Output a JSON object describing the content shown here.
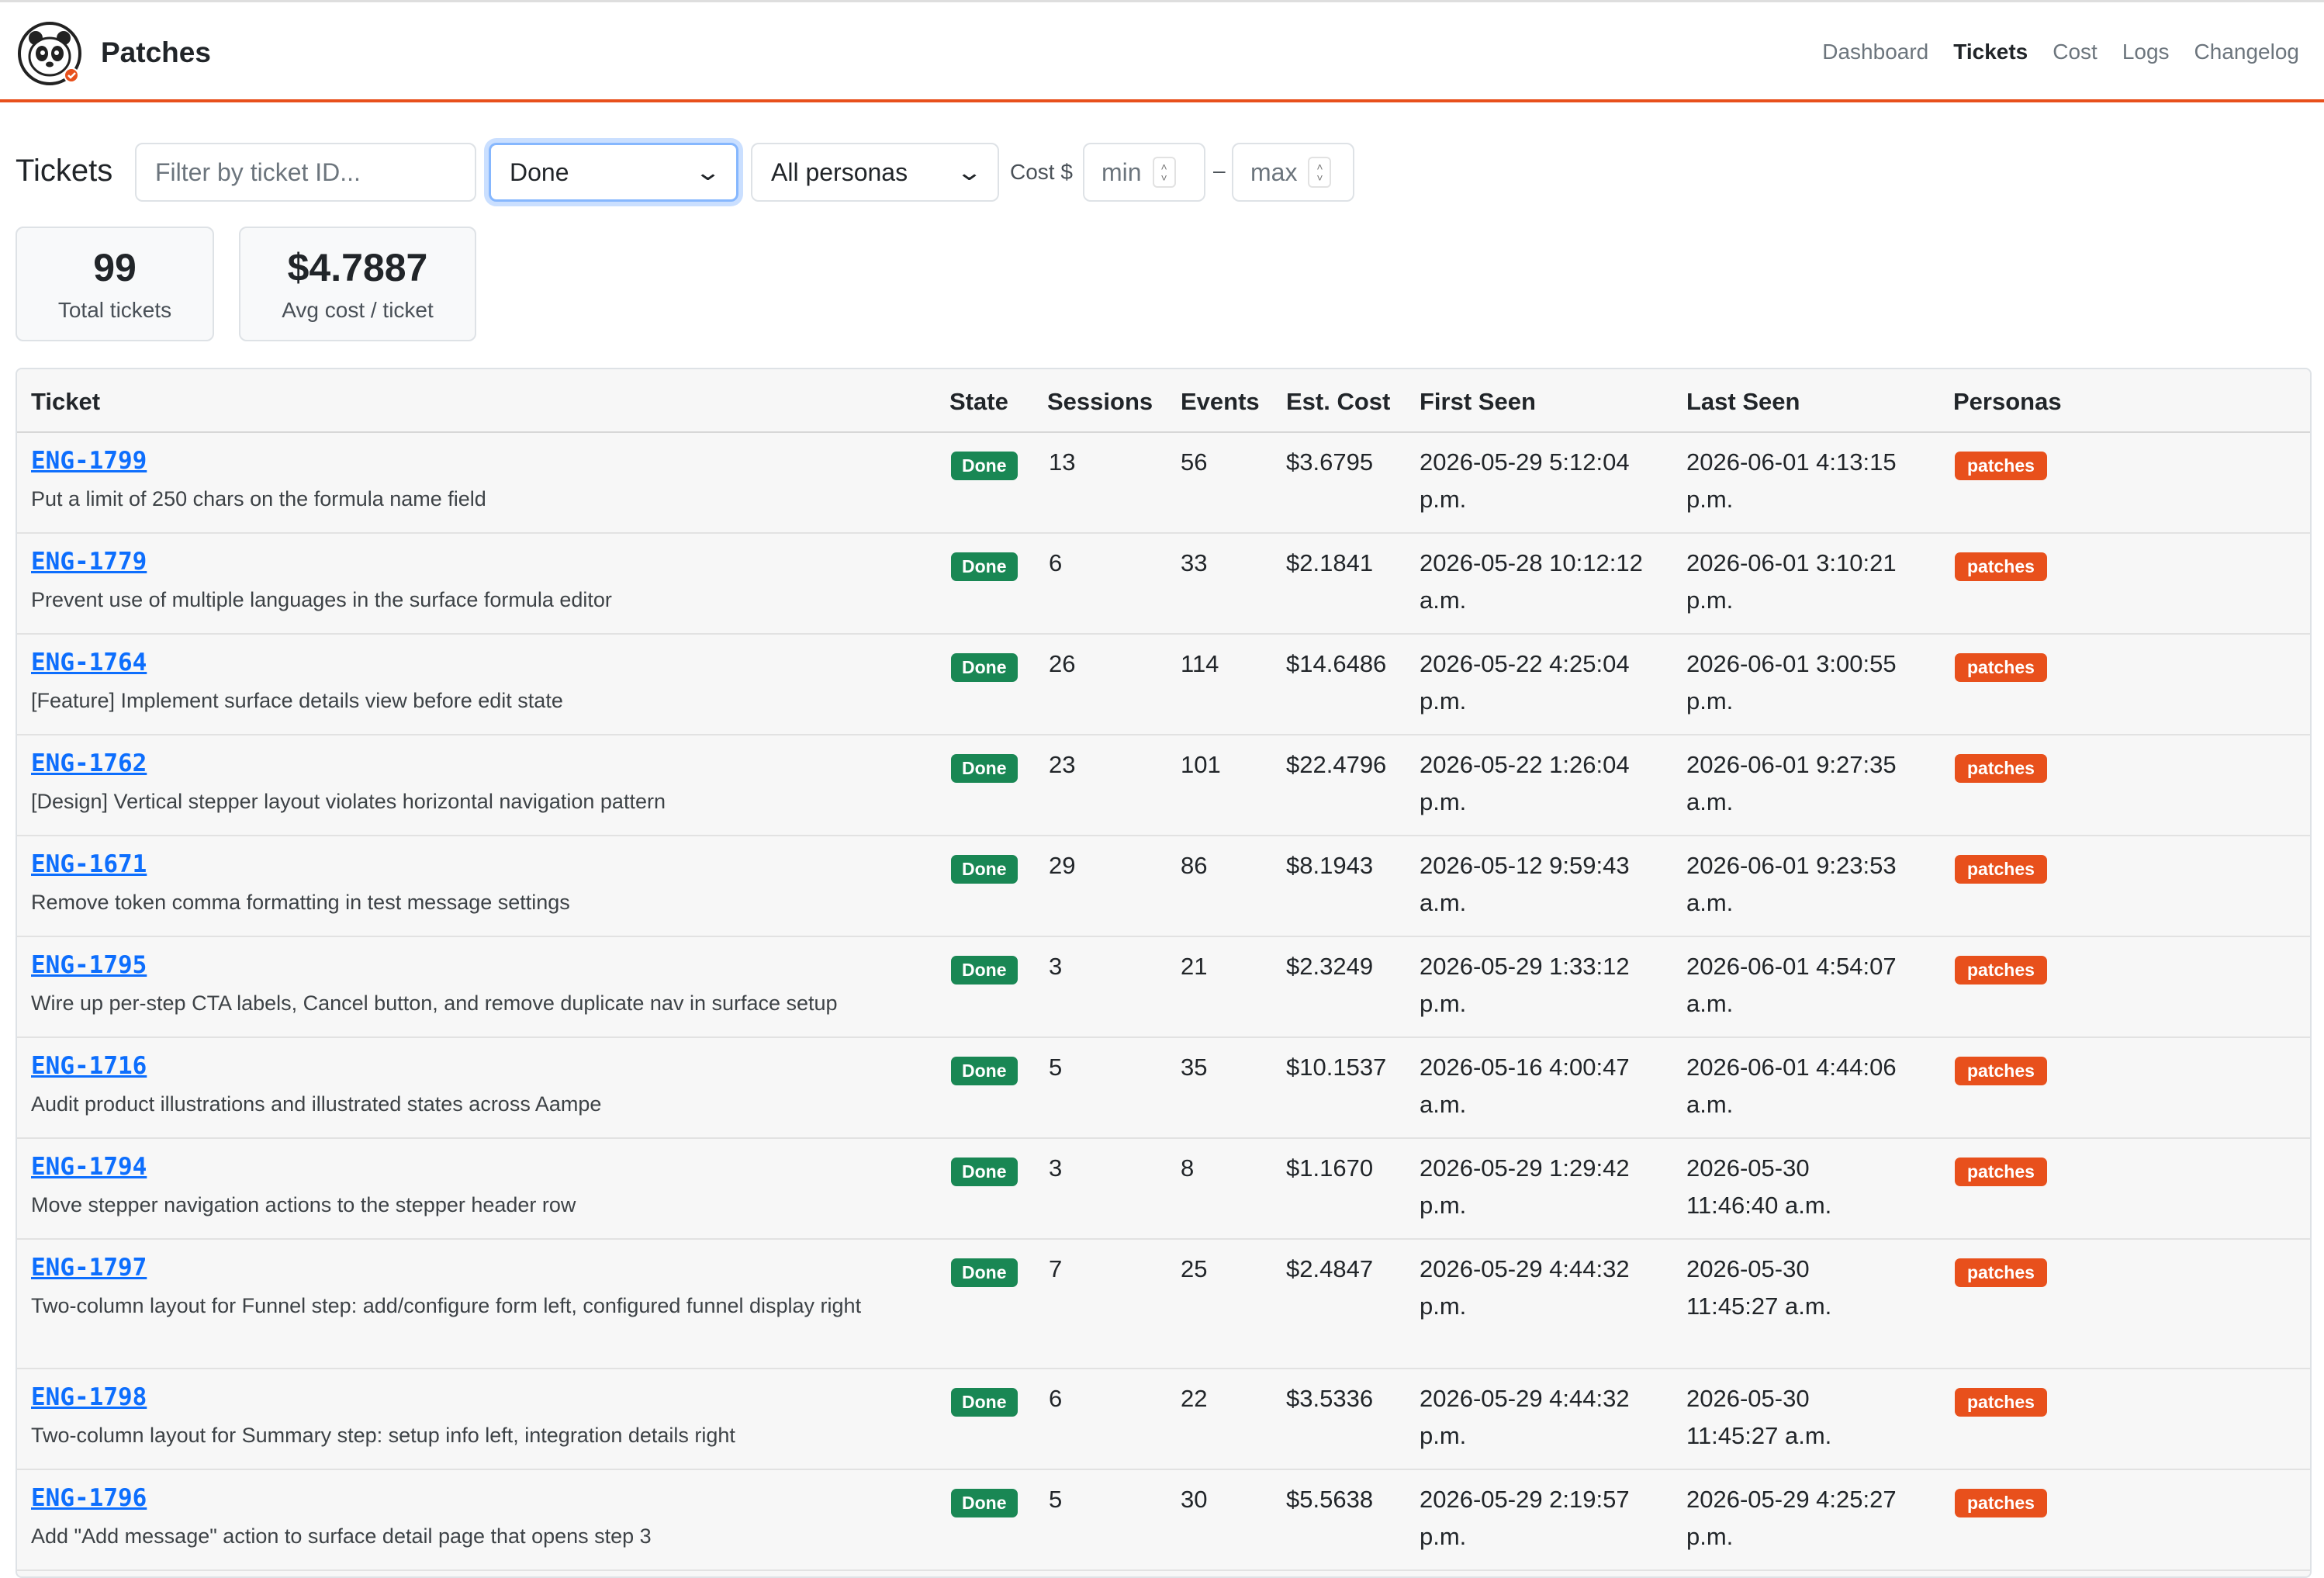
{
  "app": {
    "title": "Patches"
  },
  "nav": [
    {
      "label": "Dashboard",
      "active": false
    },
    {
      "label": "Tickets",
      "active": true
    },
    {
      "label": "Cost",
      "active": false
    },
    {
      "label": "Logs",
      "active": false
    },
    {
      "label": "Changelog",
      "active": false
    }
  ],
  "filters": {
    "title": "Tickets",
    "ticket_placeholder": "Filter by ticket ID...",
    "state_selected": "Done",
    "persona_selected": "All personas",
    "cost_label": "Cost $",
    "min_placeholder": "min",
    "max_placeholder": "max",
    "range_dash": "–"
  },
  "stats": {
    "total": {
      "value": "99",
      "label": "Total tickets"
    },
    "avg": {
      "value": "$4.7887",
      "label": "Avg cost / ticket"
    }
  },
  "table": {
    "headers": [
      "Ticket",
      "State",
      "Sessions",
      "Events",
      "Est. Cost",
      "First Seen",
      "Last Seen",
      "Personas"
    ],
    "rows": [
      {
        "id": "ENG-1799",
        "desc": "Put a limit of 250 chars on the formula name field",
        "state": "Done",
        "sessions": "13",
        "events": "56",
        "cost": "$3.6795",
        "first1": "2026-05-29 5:12:04",
        "first2": "p.m.",
        "last1": "2026-06-01 4:13:15",
        "last2": "p.m.",
        "persona": "patches"
      },
      {
        "id": "ENG-1779",
        "desc": "Prevent use of multiple languages in the surface formula editor",
        "state": "Done",
        "sessions": "6",
        "events": "33",
        "cost": "$2.1841",
        "first1": "2026-05-28 10:12:12",
        "first2": "a.m.",
        "last1": "2026-06-01 3:10:21",
        "last2": "p.m.",
        "persona": "patches"
      },
      {
        "id": "ENG-1764",
        "desc": "[Feature] Implement surface details view before edit state",
        "state": "Done",
        "sessions": "26",
        "events": "114",
        "cost": "$14.6486",
        "first1": "2026-05-22 4:25:04",
        "first2": "p.m.",
        "last1": "2026-06-01 3:00:55",
        "last2": "p.m.",
        "persona": "patches"
      },
      {
        "id": "ENG-1762",
        "desc": "[Design] Vertical stepper layout violates horizontal navigation pattern",
        "state": "Done",
        "sessions": "23",
        "events": "101",
        "cost": "$22.4796",
        "first1": "2026-05-22 1:26:04",
        "first2": "p.m.",
        "last1": "2026-06-01 9:27:35",
        "last2": "a.m.",
        "persona": "patches"
      },
      {
        "id": "ENG-1671",
        "desc": "Remove token comma formatting in test message settings",
        "state": "Done",
        "sessions": "29",
        "events": "86",
        "cost": "$8.1943",
        "first1": "2026-05-12 9:59:43",
        "first2": "a.m.",
        "last1": "2026-06-01 9:23:53",
        "last2": "a.m.",
        "persona": "patches"
      },
      {
        "id": "ENG-1795",
        "desc": "Wire up per-step CTA labels, Cancel button, and remove duplicate nav in surface setup",
        "state": "Done",
        "sessions": "3",
        "events": "21",
        "cost": "$2.3249",
        "first1": "2026-05-29 1:33:12",
        "first2": "p.m.",
        "last1": "2026-06-01 4:54:07",
        "last2": "a.m.",
        "persona": "patches"
      },
      {
        "id": "ENG-1716",
        "desc": "Audit product illustrations and illustrated states across Aampe",
        "state": "Done",
        "sessions": "5",
        "events": "35",
        "cost": "$10.1537",
        "first1": "2026-05-16 4:00:47",
        "first2": "a.m.",
        "last1": "2026-06-01 4:44:06",
        "last2": "a.m.",
        "persona": "patches"
      },
      {
        "id": "ENG-1794",
        "desc": "Move stepper navigation actions to the stepper header row",
        "state": "Done",
        "sessions": "3",
        "events": "8",
        "cost": "$1.1670",
        "first1": "2026-05-29 1:29:42",
        "first2": "p.m.",
        "last1": "2026-05-30",
        "last2": "11:46:40 a.m.",
        "persona": "patches"
      },
      {
        "id": "ENG-1797",
        "desc": "Two-column layout for Funnel step: add/configure form left, configured funnel display right",
        "state": "Done",
        "sessions": "7",
        "events": "25",
        "cost": "$2.4847",
        "first1": "2026-05-29 4:44:32",
        "first2": "p.m.",
        "last1": "2026-05-30",
        "last2": "11:45:27 a.m.",
        "persona": "patches"
      },
      {
        "id": "ENG-1798",
        "desc": "Two-column layout for Summary step: setup info left, integration details right",
        "state": "Done",
        "sessions": "6",
        "events": "22",
        "cost": "$3.5336",
        "first1": "2026-05-29 4:44:32",
        "first2": "p.m.",
        "last1": "2026-05-30",
        "last2": "11:45:27 a.m.",
        "persona": "patches"
      },
      {
        "id": "ENG-1796",
        "desc": "Add \"Add message\" action to surface detail page that opens step 3",
        "state": "Done",
        "sessions": "5",
        "events": "30",
        "cost": "$5.5638",
        "first1": "2026-05-29 2:19:57",
        "first2": "p.m.",
        "last1": "2026-05-29 4:25:27",
        "last2": "p.m.",
        "persona": "patches"
      }
    ]
  }
}
